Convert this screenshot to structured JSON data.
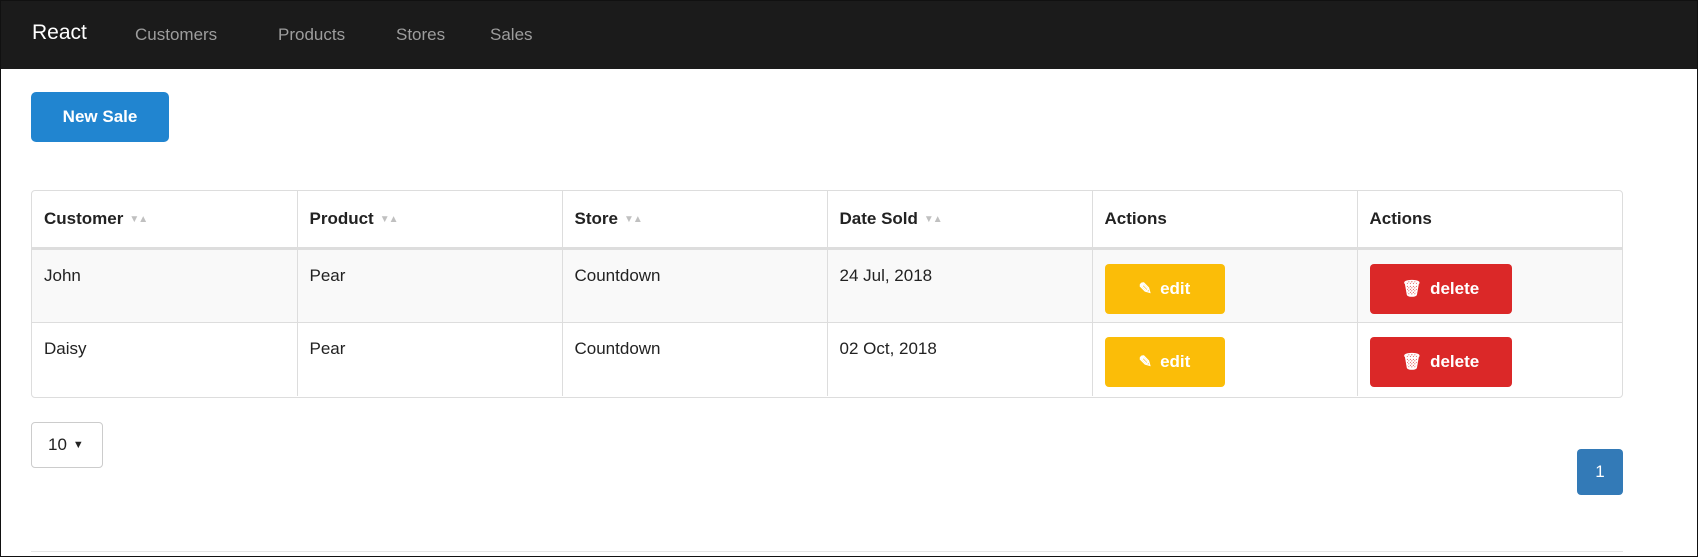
{
  "navbar": {
    "brand": "React",
    "links": [
      "Customers",
      "Products",
      "Stores",
      "Sales"
    ]
  },
  "actions": {
    "new_sale_label": "New Sale"
  },
  "table": {
    "columns": [
      "Customer",
      "Product",
      "Store",
      "Date Sold",
      "Actions",
      "Actions"
    ],
    "sortable": [
      true,
      true,
      true,
      true,
      false,
      false
    ],
    "rows": [
      {
        "customer": "John",
        "product": "Pear",
        "store": "Countdown",
        "date_sold": "24 Jul, 2018",
        "edit_label": "edit",
        "delete_label": "delete"
      },
      {
        "customer": "Daisy",
        "product": "Pear",
        "store": "Countdown",
        "date_sold": "02 Oct, 2018",
        "edit_label": "edit",
        "delete_label": "delete"
      }
    ]
  },
  "pagination": {
    "per_page": "10",
    "current_page": "1"
  },
  "colors": {
    "navbar_bg": "#1b1b1b",
    "primary": "#2185d0",
    "edit": "#fbbd08",
    "delete": "#db2828",
    "page_active": "#337ab7"
  },
  "icons": {
    "edit": "edit-icon",
    "delete": "trash-icon",
    "sort": "sort-caret-icon",
    "dropdown": "caret-down-icon"
  }
}
